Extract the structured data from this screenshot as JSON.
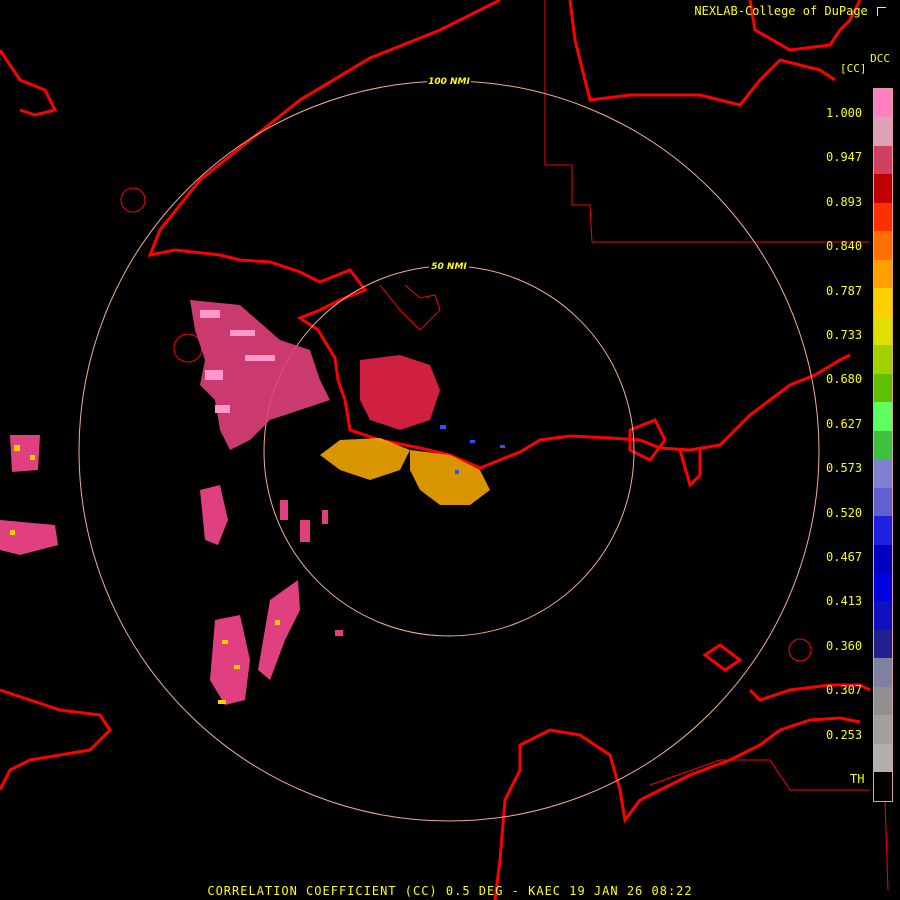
{
  "header": {
    "credit": "NEXLAB-College of DuPage",
    "credit_icon": "arrow-corner-icon",
    "product_code": "DCC",
    "unit_label": "[CC]"
  },
  "range_rings": [
    {
      "label": "100 NMI"
    },
    {
      "label": "50 NMI"
    }
  ],
  "legend": {
    "ticks": [
      "1.000",
      "0.947",
      "0.893",
      "0.840",
      "0.787",
      "0.733",
      "0.680",
      "0.627",
      "0.573",
      "0.520",
      "0.467",
      "0.413",
      "0.360",
      "0.307",
      "0.253",
      "TH"
    ],
    "colors": [
      "#ff80c0",
      "#e0a0b8",
      "#d04060",
      "#c00000",
      "#ff3000",
      "#ff7000",
      "#ffa000",
      "#ffd000",
      "#e0e000",
      "#a0d000",
      "#60c000",
      "#60ff60",
      "#40c040",
      "#8080d0",
      "#6060d0",
      "#2020e0",
      "#0000c0",
      "#0000e0",
      "#1010c0",
      "#202090",
      "#8080a0",
      "#909090",
      "#a0a0a0",
      "#b0b0b0",
      "#000000"
    ]
  },
  "footer": {
    "title": "CORRELATION COEFFICIENT (CC) 0.5 DEG - KAEC 19 JAN 26 08:22"
  },
  "colors": {
    "text": "#ffff00",
    "coastline": "#ff0000",
    "ring": "#f0b090",
    "background": "#000000"
  }
}
